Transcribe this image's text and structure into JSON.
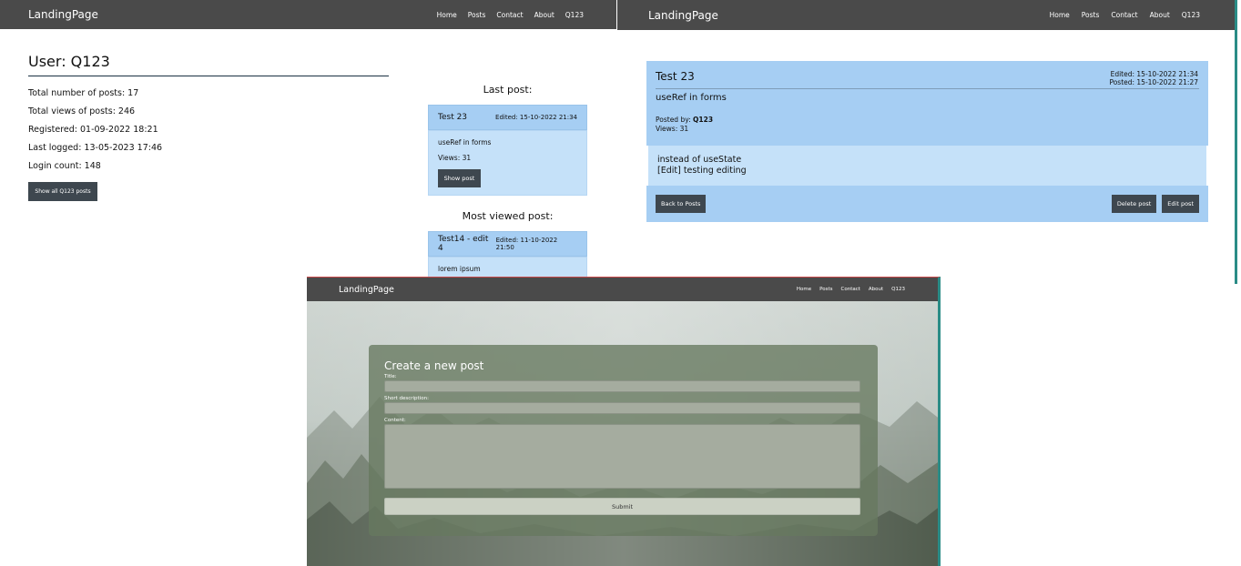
{
  "profile_window": {
    "brand": "LandingPage",
    "nav": [
      "Home",
      "Posts",
      "Contact",
      "About",
      "Q123"
    ],
    "user_title": "User: Q123",
    "stats": [
      {
        "label": "Total number of posts: ",
        "value": "17"
      },
      {
        "label": "Total views of posts: ",
        "value": "246"
      },
      {
        "label": "Registered: ",
        "value": "01-09-2022 18:21"
      },
      {
        "label": "Last logged: ",
        "value": "13-05-2023 17:46"
      },
      {
        "label": "Login count: ",
        "value": "148"
      }
    ],
    "show_all_label": "Show all Q123 posts",
    "last_post": {
      "heading": "Last post:",
      "title": "Test 23",
      "edited": "Edited: 15-10-2022 21:34",
      "desc": "useRef in forms",
      "views": "Views: 31",
      "button": "Show post"
    },
    "most_viewed": {
      "heading": "Most viewed post:",
      "title": "Test14 - edit 4",
      "edited": "Edited: 11-10-2022 21:50",
      "desc": "lorem ipsum"
    }
  },
  "detail_window": {
    "brand": "LandingPage",
    "nav": [
      "Home",
      "Posts",
      "Contact",
      "About",
      "Q123"
    ],
    "title": "Test 23",
    "edited": "Edited: 15-10-2022 21:34",
    "posted": "Posted: 15-10-2022 21:27",
    "description": "useRef in forms",
    "posted_by_label": "Posted by: ",
    "posted_by": "Q123",
    "views": "Views: 31",
    "content_line1": "instead of useState",
    "content_line2": "[Edit] testing editing",
    "back_label": "Back to Posts",
    "delete_label": "Delete post",
    "edit_label": "Edit post"
  },
  "create_window": {
    "brand": "LandingPage",
    "nav": [
      "Home",
      "Posts",
      "Contact",
      "About",
      "Q123"
    ],
    "form_title": "Create a new post",
    "title_label": "Title:",
    "short_label": "Short description:",
    "content_label": "Content:",
    "submit_label": "Submit"
  },
  "colors": {
    "navbar": "#4a4a4a",
    "card_header": "#a6cef3",
    "card_body": "#c5e1f9",
    "dark_button": "#3e474f",
    "accent_border": "#2a8c86"
  }
}
